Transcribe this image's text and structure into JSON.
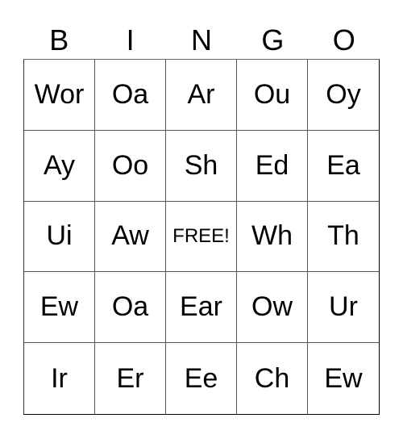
{
  "header": {
    "letters": [
      "B",
      "I",
      "N",
      "G",
      "O"
    ]
  },
  "board": {
    "rows": [
      [
        "Wor",
        "Oa",
        "Ar",
        "Ou",
        "Oy"
      ],
      [
        "Ay",
        "Oo",
        "Sh",
        "Ed",
        "Ea"
      ],
      [
        "Ui",
        "Aw",
        "FREE!",
        "Wh",
        "Th"
      ],
      [
        "Ew",
        "Oa",
        "Ear",
        "Ow",
        "Ur"
      ],
      [
        "Ir",
        "Er",
        "Ee",
        "Ch",
        "Ew"
      ]
    ]
  }
}
